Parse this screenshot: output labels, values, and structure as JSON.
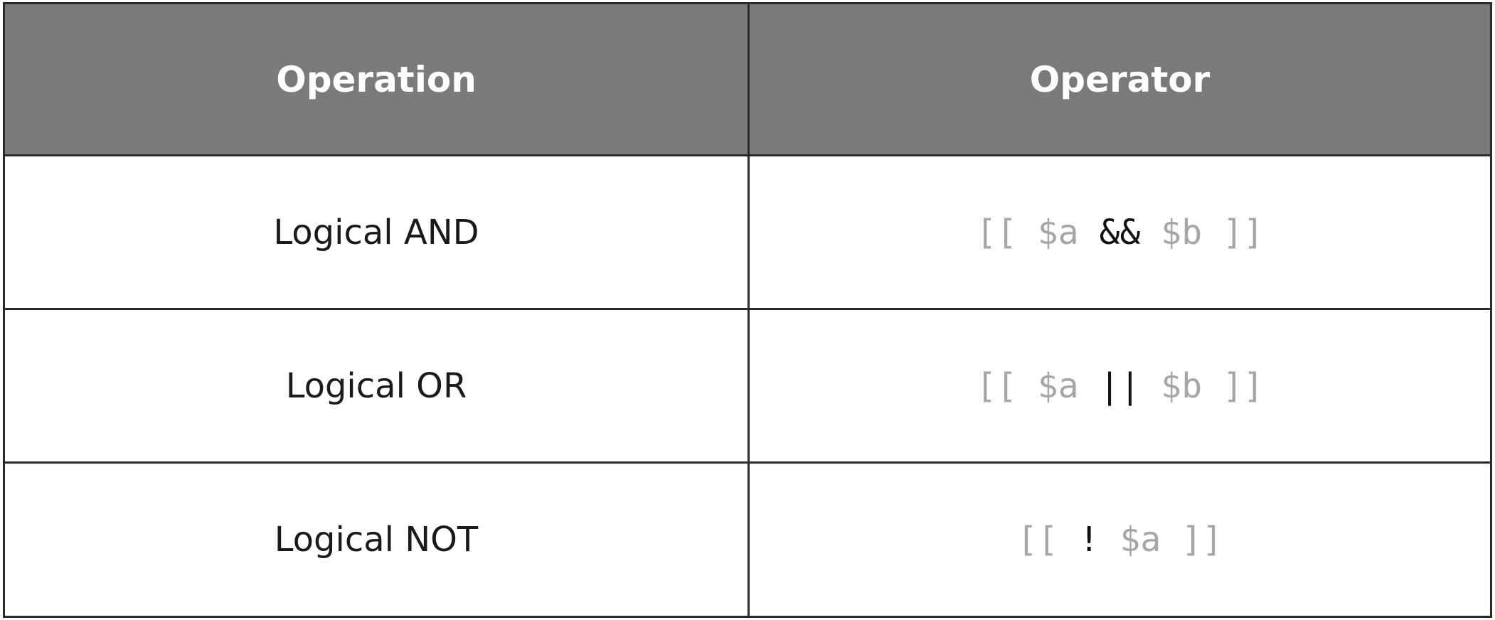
{
  "table": {
    "headers": [
      "Operation",
      "Operator"
    ],
    "rows": [
      {
        "operation": "Logical AND",
        "pre": "[[ $a ",
        "op": "&&",
        "post": " $b ]]"
      },
      {
        "operation": "Logical OR",
        "pre": "[[ $a ",
        "op": "||",
        "post": " $b ]]"
      },
      {
        "operation": "Logical NOT",
        "pre": "[[ ",
        "op": "!",
        "post": " $a ]]"
      }
    ]
  },
  "colors": {
    "header_bg": "#7a7a7a",
    "header_text": "#ffffff",
    "border": "#2a2a2a",
    "code_muted": "#a6a6a6",
    "code_operator": "#111111"
  }
}
